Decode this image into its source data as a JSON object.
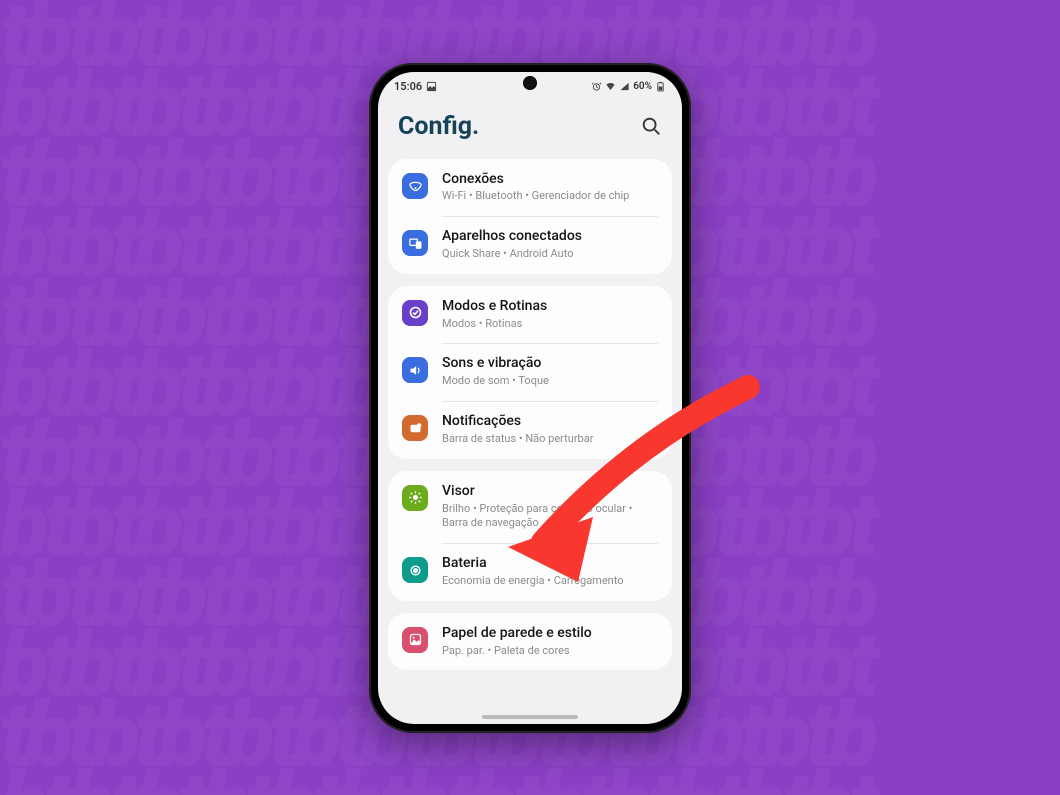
{
  "statusbar": {
    "time": "15:06",
    "battery": "60%"
  },
  "header": {
    "title": "Config."
  },
  "groups": [
    {
      "items": [
        {
          "icon": "wifi",
          "color": "#3a6de0",
          "title": "Conexões",
          "sub": "Wi-Fi • Bluetooth • Gerenciador de chip"
        },
        {
          "icon": "devices",
          "color": "#3a6de0",
          "title": "Aparelhos conectados",
          "sub": "Quick Share • Android Auto"
        }
      ]
    },
    {
      "items": [
        {
          "icon": "check",
          "color": "#6a40c8",
          "title": "Modos e Rotinas",
          "sub": "Modos • Rotinas"
        },
        {
          "icon": "sound",
          "color": "#3a6de0",
          "title": "Sons e vibração",
          "sub": "Modo de som • Toque"
        },
        {
          "icon": "notif",
          "color": "#d36a2d",
          "title": "Notificações",
          "sub": "Barra de status • Não perturbar"
        }
      ]
    },
    {
      "items": [
        {
          "icon": "sun",
          "color": "#6bab1e",
          "title": "Visor",
          "sub": "Brilho • Proteção para conforto ocular • Barra de navegação"
        },
        {
          "icon": "battery",
          "color": "#0d9b8c",
          "title": "Bateria",
          "sub": "Economia de energia • Carregamento"
        }
      ]
    },
    {
      "items": [
        {
          "icon": "palette",
          "color": "#d9506f",
          "title": "Papel de parede e estilo",
          "sub": "Pap. par. • Paleta de cores"
        }
      ]
    }
  ]
}
